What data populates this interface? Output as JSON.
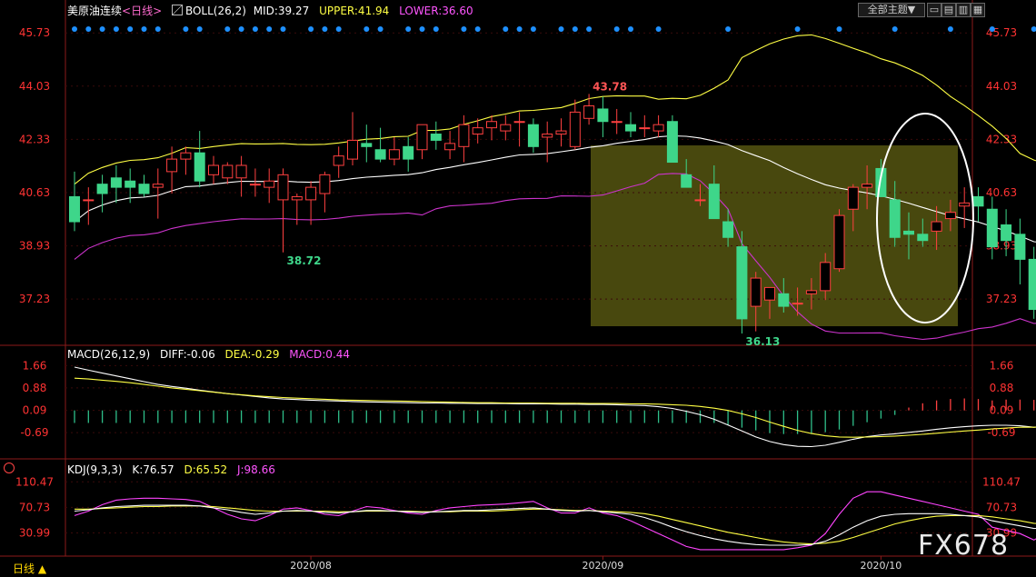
{
  "header": {
    "instrument": "美原油连续",
    "period": "<日线>",
    "indicator_icon": "boll-icon",
    "boll_label": "BOLL(26,2)",
    "mid": "MID:39.27",
    "upper": "UPPER:41.94",
    "lower": "LOWER:36.60",
    "topic_button": "全部主题▼"
  },
  "macd_header": {
    "name": "MACD(26,12,9)",
    "diff": "DIFF:-0.06",
    "dea": "DEA:-0.29",
    "macd": "MACD:0.44"
  },
  "kdj_header": {
    "name": "KDJ(9,3,3)",
    "k": "K:76.57",
    "d": "D:65.52",
    "j": "J:98.66"
  },
  "bottom": {
    "tab": "日线 ▲",
    "watermark": "FX678"
  },
  "colors": {
    "up": "#ff4040",
    "down": "#3ed68a",
    "mid": "#ffffff",
    "upper": "#ffff44",
    "lower": "#cc33cc",
    "axis": "#ff3333",
    "highlight": "#555511"
  },
  "chart_data": [
    {
      "type": "candlestick",
      "name": "price",
      "yticks": [
        "45.73",
        "44.03",
        "42.33",
        "40.63",
        "38.93",
        "37.23"
      ],
      "ylim": [
        35.9,
        46.2
      ],
      "xticks": [
        "2020/08",
        "2020/09",
        "2020/10"
      ],
      "annotations": [
        "43.78",
        "38.72",
        "36.13",
        "36.6"
      ],
      "candles": [
        [
          40.5,
          41.3,
          39.4,
          39.7
        ],
        [
          40.4,
          40.8,
          39.6,
          40.4
        ],
        [
          40.9,
          41.2,
          40.0,
          40.6
        ],
        [
          41.1,
          41.5,
          40.3,
          40.8
        ],
        [
          41.0,
          41.4,
          40.3,
          40.8
        ],
        [
          40.9,
          41.2,
          40.5,
          40.6
        ],
        [
          40.8,
          41.4,
          39.8,
          40.9
        ],
        [
          41.3,
          42.1,
          40.6,
          41.7
        ],
        [
          41.7,
          42.1,
          41.2,
          41.9
        ],
        [
          41.9,
          42.6,
          40.8,
          41.0
        ],
        [
          41.2,
          41.8,
          40.9,
          41.5
        ],
        [
          41.1,
          41.6,
          40.9,
          41.5
        ],
        [
          41.1,
          41.8,
          40.5,
          41.5
        ],
        [
          40.9,
          41.4,
          40.5,
          40.9
        ],
        [
          40.8,
          41.4,
          40.3,
          41.0
        ],
        [
          40.4,
          41.4,
          38.72,
          41.2
        ],
        [
          40.4,
          40.6,
          39.6,
          40.5
        ],
        [
          40.4,
          41.0,
          39.6,
          40.8
        ],
        [
          40.6,
          41.3,
          40.0,
          41.2
        ],
        [
          41.5,
          42.1,
          41.1,
          41.8
        ],
        [
          41.7,
          43.2,
          41.5,
          42.3
        ],
        [
          42.2,
          42.8,
          41.6,
          42.1
        ],
        [
          42.0,
          42.7,
          41.6,
          41.7
        ],
        [
          41.7,
          42.4,
          41.5,
          42.0
        ],
        [
          42.1,
          42.4,
          41.3,
          41.7
        ],
        [
          42.0,
          42.8,
          41.7,
          42.8
        ],
        [
          42.5,
          42.9,
          42.0,
          42.3
        ],
        [
          42.0,
          42.6,
          41.7,
          42.2
        ],
        [
          42.1,
          43.1,
          41.6,
          42.8
        ],
        [
          42.5,
          43.0,
          42.2,
          42.7
        ],
        [
          42.7,
          43.1,
          42.3,
          42.9
        ],
        [
          42.6,
          43.1,
          42.3,
          42.8
        ],
        [
          42.9,
          43.2,
          42.1,
          42.9
        ],
        [
          42.8,
          43.0,
          41.9,
          42.1
        ],
        [
          42.4,
          42.9,
          41.6,
          42.5
        ],
        [
          42.5,
          43.0,
          42.1,
          42.6
        ],
        [
          42.1,
          43.6,
          42.0,
          43.2
        ],
        [
          43.0,
          43.78,
          42.8,
          43.4
        ],
        [
          43.3,
          43.7,
          42.4,
          42.9
        ],
        [
          42.9,
          43.3,
          42.5,
          42.9
        ],
        [
          42.8,
          43.2,
          42.4,
          42.6
        ],
        [
          42.7,
          43.1,
          42.4,
          42.7
        ],
        [
          42.6,
          43.1,
          42.4,
          42.8
        ],
        [
          42.9,
          43.1,
          41.6,
          41.6
        ],
        [
          41.2,
          41.7,
          40.8,
          40.8
        ],
        [
          40.4,
          40.9,
          40.2,
          40.4
        ],
        [
          40.9,
          41.5,
          39.8,
          39.8
        ],
        [
          39.7,
          40.1,
          38.9,
          39.2
        ],
        [
          38.9,
          39.4,
          36.13,
          36.6
        ],
        [
          37.0,
          38.1,
          36.2,
          37.9
        ],
        [
          37.2,
          37.6,
          36.6,
          37.6
        ],
        [
          37.4,
          37.9,
          36.8,
          37.0
        ],
        [
          37.1,
          37.6,
          36.7,
          37.1
        ],
        [
          37.4,
          37.9,
          36.9,
          37.5
        ],
        [
          37.5,
          38.7,
          37.2,
          38.4
        ],
        [
          38.2,
          40.1,
          38.1,
          39.9
        ],
        [
          40.1,
          40.9,
          39.4,
          40.8
        ],
        [
          40.8,
          41.5,
          40.1,
          40.9
        ],
        [
          41.4,
          41.7,
          40.6,
          40.5
        ],
        [
          40.4,
          41.0,
          38.9,
          39.2
        ],
        [
          39.4,
          40.0,
          38.5,
          39.3
        ],
        [
          39.3,
          39.8,
          38.9,
          39.1
        ],
        [
          39.4,
          40.2,
          38.8,
          39.7
        ],
        [
          39.8,
          40.4,
          39.4,
          40.0
        ],
        [
          40.2,
          40.8,
          39.5,
          40.3
        ],
        [
          40.5,
          40.8,
          39.7,
          40.2
        ],
        [
          40.1,
          40.5,
          38.5,
          38.9
        ],
        [
          39.6,
          40.1,
          38.6,
          39.1
        ],
        [
          39.3,
          39.8,
          37.7,
          38.5
        ],
        [
          38.5,
          38.9,
          36.6,
          36.9
        ],
        [
          36.9,
          39.8,
          36.7,
          39.6
        ],
        [
          39.2,
          39.7,
          38.9,
          39.5
        ],
        [
          39.5,
          40.6,
          39.3,
          39.8
        ],
        [
          39.8,
          40.3,
          39.3,
          40.3
        ],
        [
          40.2,
          41.4,
          39.8,
          41.2
        ],
        [
          41.3,
          41.5,
          40.5,
          40.6
        ]
      ]
    },
    {
      "type": "macd",
      "yticks": [
        "1.66",
        "0.88",
        "0.09",
        "-0.69"
      ],
      "ylim": [
        -1.45,
        1.8
      ],
      "diff": [
        1.61,
        1.5,
        1.4,
        1.3,
        1.2,
        1.1,
        1.0,
        0.93,
        0.87,
        0.8,
        0.74,
        0.68,
        0.63,
        0.58,
        0.53,
        0.49,
        0.47,
        0.45,
        0.43,
        0.42,
        0.4,
        0.39,
        0.38,
        0.37,
        0.36,
        0.35,
        0.35,
        0.34,
        0.34,
        0.33,
        0.33,
        0.33,
        0.32,
        0.32,
        0.32,
        0.31,
        0.31,
        0.3,
        0.3,
        0.29,
        0.27,
        0.26,
        0.22,
        0.16,
        0.06,
        -0.06,
        -0.22,
        -0.42,
        -0.63,
        -0.84,
        -1.0,
        -1.11,
        -1.17,
        -1.18,
        -1.13,
        -1.03,
        -0.92,
        -0.83,
        -0.77,
        -0.73,
        -0.68,
        -0.63,
        -0.57,
        -0.52,
        -0.48,
        -0.45,
        -0.43,
        -0.43,
        -0.45,
        -0.5,
        -0.45,
        -0.37,
        -0.28,
        -0.19,
        -0.11,
        -0.06
      ],
      "dea": [
        1.22,
        1.19,
        1.15,
        1.11,
        1.06,
        1.0,
        0.94,
        0.88,
        0.83,
        0.78,
        0.73,
        0.68,
        0.64,
        0.6,
        0.57,
        0.54,
        0.52,
        0.5,
        0.48,
        0.46,
        0.45,
        0.44,
        0.43,
        0.42,
        0.41,
        0.4,
        0.39,
        0.38,
        0.37,
        0.36,
        0.36,
        0.35,
        0.35,
        0.35,
        0.34,
        0.34,
        0.34,
        0.33,
        0.33,
        0.33,
        0.32,
        0.32,
        0.31,
        0.29,
        0.27,
        0.23,
        0.17,
        0.09,
        -0.03,
        -0.16,
        -0.32,
        -0.47,
        -0.61,
        -0.72,
        -0.8,
        -0.84,
        -0.85,
        -0.84,
        -0.83,
        -0.81,
        -0.78,
        -0.75,
        -0.71,
        -0.67,
        -0.63,
        -0.6,
        -0.56,
        -0.53,
        -0.5,
        -0.5,
        -0.48,
        -0.45,
        -0.42,
        -0.38,
        -0.33,
        -0.29
      ],
      "hist": [
        -0.69,
        -0.69,
        -0.69,
        -0.69,
        -0.69,
        -0.69,
        -0.69,
        -0.69,
        -0.69,
        -0.69,
        -0.69,
        -0.69,
        -0.69,
        -0.69,
        -0.69,
        -0.69,
        -0.69,
        -0.69,
        -0.69,
        -0.69,
        -0.69,
        -0.69,
        -0.69,
        -0.69,
        -0.69,
        -0.69,
        -0.69,
        -0.69,
        -0.69,
        -0.69,
        -0.69,
        -0.69,
        -0.69,
        -0.69,
        -0.69,
        -0.69,
        -0.69,
        -0.69,
        -0.69,
        -0.69,
        -0.69,
        -0.69,
        -0.69,
        -0.69,
        -0.69,
        -0.69,
        -0.69,
        -0.8,
        -0.95,
        -1.1,
        -1.25,
        -1.3,
        -1.3,
        -1.3,
        -1.2,
        -1.05,
        -0.85,
        -0.65,
        -0.45,
        -0.25,
        0.1,
        0.25,
        0.35,
        0.4,
        0.42,
        0.4,
        0.35,
        0.38,
        0.38,
        0.37,
        0.35,
        0.38,
        0.3,
        0.35,
        0.41,
        0.44
      ],
      "series": [
        {
          "name": "DIFF"
        },
        {
          "name": "DEA"
        },
        {
          "name": "MACD"
        }
      ]
    },
    {
      "type": "kdj",
      "yticks": [
        "110.47",
        "70.73",
        "30.99"
      ],
      "ylim": [
        -5,
        125
      ],
      "k": [
        65,
        67,
        70,
        72,
        73,
        74,
        74,
        74,
        74,
        73,
        70,
        67,
        63,
        60,
        62,
        65,
        66,
        65,
        63,
        62,
        64,
        66,
        66,
        65,
        64,
        63,
        64,
        65,
        66,
        66,
        67,
        68,
        69,
        70,
        68,
        66,
        65,
        66,
        64,
        62,
        60,
        55,
        48,
        40,
        33,
        27,
        22,
        18,
        15,
        13,
        12,
        12,
        12,
        13,
        18,
        28,
        40,
        50,
        57,
        60,
        61,
        61,
        61,
        60,
        58,
        56,
        50,
        46,
        42,
        38,
        40,
        48,
        56,
        64,
        70,
        76.57
      ],
      "d": [
        68,
        68,
        69,
        70,
        71,
        72,
        72,
        73,
        73,
        73,
        72,
        70,
        68,
        66,
        65,
        65,
        65,
        65,
        65,
        64,
        64,
        65,
        65,
        65,
        65,
        64,
        64,
        64,
        65,
        65,
        65,
        66,
        67,
        68,
        68,
        67,
        66,
        66,
        65,
        64,
        63,
        61,
        57,
        52,
        47,
        42,
        37,
        32,
        28,
        24,
        20,
        17,
        15,
        14,
        15,
        18,
        24,
        31,
        38,
        45,
        50,
        54,
        57,
        58,
        58,
        58,
        56,
        53,
        50,
        46,
        44,
        45,
        48,
        53,
        59,
        65.52
      ],
      "j": [
        58,
        65,
        75,
        82,
        84,
        85,
        85,
        84,
        83,
        80,
        70,
        60,
        53,
        50,
        58,
        68,
        70,
        66,
        60,
        58,
        65,
        72,
        70,
        66,
        62,
        60,
        66,
        70,
        72,
        74,
        75,
        76,
        78,
        80,
        70,
        62,
        62,
        70,
        62,
        58,
        50,
        40,
        30,
        20,
        10,
        5,
        5,
        5,
        5,
        5,
        5,
        5,
        8,
        12,
        30,
        60,
        85,
        95,
        95,
        90,
        85,
        80,
        75,
        70,
        65,
        60,
        40,
        35,
        30,
        20,
        32,
        55,
        75,
        90,
        100,
        98.66
      ],
      "series": [
        {
          "name": "K"
        },
        {
          "name": "D"
        },
        {
          "name": "J"
        }
      ]
    }
  ]
}
